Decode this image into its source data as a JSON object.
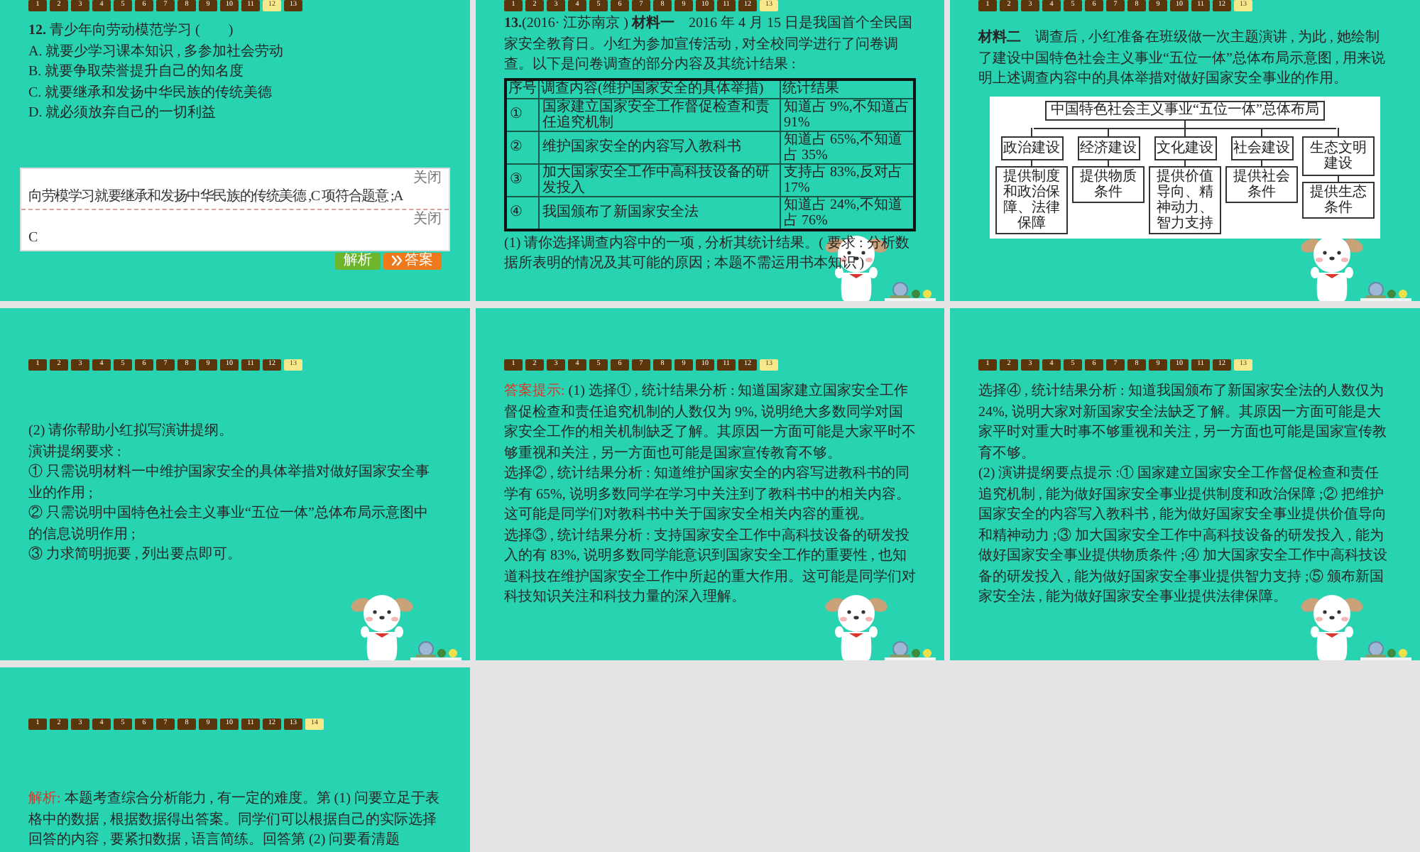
{
  "slides": [
    {
      "kind": "question",
      "mascot": false,
      "nav": [
        {
          "label": "1",
          "selected": false
        },
        {
          "label": "2",
          "selected": false
        },
        {
          "label": "3",
          "selected": false
        },
        {
          "label": "4",
          "selected": false
        },
        {
          "label": "5",
          "selected": false
        },
        {
          "label": "6",
          "selected": false
        },
        {
          "label": "7",
          "selected": false
        },
        {
          "label": "8",
          "selected": false
        },
        {
          "label": "9",
          "selected": false
        },
        {
          "label": "10",
          "selected": false
        },
        {
          "label": "11",
          "selected": false
        },
        {
          "label": "12",
          "selected": true
        },
        {
          "label": "13",
          "selected": false
        }
      ],
      "question": "**12.** 青少年向劳动模范学习 (　　)",
      "options": [
        "A. 就要少学习课本知识 , 多参加社会劳动",
        "B. 就要争取荣誉提升自己的知名度",
        "C. 就要继承和发扬中华民族的传统美德",
        "D. 就必须放弃自己的一切利益"
      ],
      "panels": [
        {
          "close": "关闭",
          "text": "向劳模学习就要继承和发扬中华民族的传统美德 ,C 项符合题意 ;A"
        },
        {
          "close": "关闭",
          "text": "C"
        }
      ],
      "buttons": [
        "解析",
        "答案"
      ]
    },
    {
      "kind": "table",
      "mascot": true,
      "nav": [
        {
          "label": "1",
          "selected": false
        },
        {
          "label": "2",
          "selected": false
        },
        {
          "label": "3",
          "selected": false
        },
        {
          "label": "4",
          "selected": false
        },
        {
          "label": "5",
          "selected": false
        },
        {
          "label": "6",
          "selected": false
        },
        {
          "label": "7",
          "selected": false
        },
        {
          "label": "8",
          "selected": false
        },
        {
          "label": "9",
          "selected": false
        },
        {
          "label": "10",
          "selected": false
        },
        {
          "label": "11",
          "selected": false
        },
        {
          "label": "12",
          "selected": false
        },
        {
          "label": "13",
          "selected": true
        }
      ],
      "intro": "**13.**(2016· 江苏南京 ) **材料一**　2016 年 4 月 15 日是我国首个全民国家安全教育日。小红为参加宣传活动 , 对全校同学进行了问卷调查。以下是问卷调查的部分内容及其统计结果 :",
      "table": {
        "columns": [
          "序号",
          "调查内容(维护国家安全的具体举措)",
          "统计结果"
        ],
        "rows": [
          [
            "①",
            "国家建立国家安全工作督促检查和责任追究机制",
            "知道占 9%,不知道占 91%"
          ],
          [
            "②",
            "维护国家安全的内容写入教科书",
            "知道占 65%,不知道占 35%"
          ],
          [
            "③",
            "加大国家安全工作中高科技设备的研发投入",
            "支持占 83%,反对占 17%"
          ],
          [
            "④",
            "我国颁布了新国家安全法",
            "知道占 24%,不知道占 76%"
          ]
        ]
      },
      "question": "(1) 请你选择调查内容中的一项 , 分析其统计结果。( 要求 : 分析数据所表明的情况及其可能的原因 ; 本题不需运用书本知识 )"
    },
    {
      "kind": "diagram",
      "mascot": true,
      "nav": [
        {
          "label": "1",
          "selected": false
        },
        {
          "label": "2",
          "selected": false
        },
        {
          "label": "3",
          "selected": false
        },
        {
          "label": "4",
          "selected": false
        },
        {
          "label": "5",
          "selected": false
        },
        {
          "label": "6",
          "selected": false
        },
        {
          "label": "7",
          "selected": false
        },
        {
          "label": "8",
          "selected": false
        },
        {
          "label": "9",
          "selected": false
        },
        {
          "label": "10",
          "selected": false
        },
        {
          "label": "11",
          "selected": false
        },
        {
          "label": "12",
          "selected": false
        },
        {
          "label": "13",
          "selected": true
        }
      ],
      "intro": "**材料二**　调查后 , 小红准备在班级做一次主题演讲 , 为此 , 她绘制了建设中国特色社会主义事业“五位一体”总体布局示意图 , 用来说明上述调查内容中的具体举措对做好国家安全事业的作用。",
      "diagram": {
        "title": "中国特色社会主义事业“五位一体”总体布局",
        "branches": [
          {
            "label": "政治建设",
            "detail": "提供制度和政治保障、法律保障"
          },
          {
            "label": "经济建设",
            "detail": "提供物质条件"
          },
          {
            "label": "文化建设",
            "detail": "提供价值导向、精神动力、智力支持"
          },
          {
            "label": "社会建设",
            "detail": "提供社会条件"
          },
          {
            "label": "生态文明建设",
            "detail": "提供生态条件"
          }
        ]
      }
    },
    {
      "kind": "prompt",
      "mascot": true,
      "nav": [
        {
          "label": "1",
          "selected": false
        },
        {
          "label": "2",
          "selected": false
        },
        {
          "label": "3",
          "selected": false
        },
        {
          "label": "4",
          "selected": false
        },
        {
          "label": "5",
          "selected": false
        },
        {
          "label": "6",
          "selected": false
        },
        {
          "label": "7",
          "selected": false
        },
        {
          "label": "8",
          "selected": false
        },
        {
          "label": "9",
          "selected": false
        },
        {
          "label": "10",
          "selected": false
        },
        {
          "label": "11",
          "selected": false
        },
        {
          "label": "12",
          "selected": false
        },
        {
          "label": "13",
          "selected": true
        }
      ],
      "paragraphs": [
        "(2) 请你帮助小红拟写演讲提纲。",
        "演讲提纲要求 :",
        "① 只需说明材料一中维护国家安全的具体举措对做好国家安全事业的作用 ;",
        "② 只需说明中国特色社会主义事业“五位一体”总体布局示意图中的信息说明作用 ;",
        "③ 力求简明扼要 , 列出要点即可。"
      ]
    },
    {
      "kind": "answer",
      "mascot": true,
      "nav": [
        {
          "label": "1",
          "selected": false
        },
        {
          "label": "2",
          "selected": false
        },
        {
          "label": "3",
          "selected": false
        },
        {
          "label": "4",
          "selected": false
        },
        {
          "label": "5",
          "selected": false
        },
        {
          "label": "6",
          "selected": false
        },
        {
          "label": "7",
          "selected": false
        },
        {
          "label": "8",
          "selected": false
        },
        {
          "label": "9",
          "selected": false
        },
        {
          "label": "10",
          "selected": false
        },
        {
          "label": "11",
          "selected": false
        },
        {
          "label": "12",
          "selected": false
        },
        {
          "label": "13",
          "selected": true
        }
      ],
      "label": "答案提示:",
      "paragraphs": [
        "(1) 选择① , 统计结果分析 : 知道国家建立国家安全工作督促检查和责任追究机制的人数仅为 9%, 说明绝大多数同学对国家安全工作的相关机制缺乏了解。其原因一方面可能是大家平时不够重视和关注 , 另一方面也可能是国家宣传教育不够。",
        "选择② , 统计结果分析 : 知道维护国家安全的内容写进教科书的同学有 65%, 说明多数同学在学习中关注到了教科书中的相关内容。这可能是同学们对教科书中关于国家安全相关内容的重视。",
        "选择③ , 统计结果分析 : 支持国家安全工作中高科技设备的研发投入的有 83%, 说明多数同学能意识到国家安全工作的重要性 , 也知道科技在维护国家安全工作中所起的重大作用。这可能是同学们对科技知识关注和科技力量的深入理解。"
      ]
    },
    {
      "kind": "answer",
      "mascot": true,
      "nav": [
        {
          "label": "1",
          "selected": false
        },
        {
          "label": "2",
          "selected": false
        },
        {
          "label": "3",
          "selected": false
        },
        {
          "label": "4",
          "selected": false
        },
        {
          "label": "5",
          "selected": false
        },
        {
          "label": "6",
          "selected": false
        },
        {
          "label": "7",
          "selected": false
        },
        {
          "label": "8",
          "selected": false
        },
        {
          "label": "9",
          "selected": false
        },
        {
          "label": "10",
          "selected": false
        },
        {
          "label": "11",
          "selected": false
        },
        {
          "label": "12",
          "selected": false
        },
        {
          "label": "13",
          "selected": true
        }
      ],
      "paragraphs": [
        "选择④ , 统计结果分析 : 知道我国颁布了新国家安全法的人数仅为 24%, 说明大家对新国家安全法缺乏了解。其原因一方面可能是大家平时对重大时事不够重视和关注 , 另一方面也可能是国家宣传教育不够。",
        "(2) 演讲提纲要点提示 :① 国家建立国家安全工作督促检查和责任追究机制 , 能为做好国家安全事业提供制度和政治保障 ;② 把维护国家安全的内容写入教科书 , 能为做好国家安全事业提供价值导向和精神动力 ;③ 加大国家安全工作中高科技设备的研发投入 , 能为做好国家安全事业提供物质条件 ;④ 加大国家安全工作中高科技设备的研发投入 , 能为做好国家安全事业提供智力支持 ;⑤ 颁布新国家安全法 , 能为做好国家安全事业提供法律保障。"
      ]
    },
    {
      "kind": "analysis",
      "mascot": false,
      "nav": [
        {
          "label": "1",
          "selected": false
        },
        {
          "label": "2",
          "selected": false
        },
        {
          "label": "3",
          "selected": false
        },
        {
          "label": "4",
          "selected": false
        },
        {
          "label": "5",
          "selected": false
        },
        {
          "label": "6",
          "selected": false
        },
        {
          "label": "7",
          "selected": false
        },
        {
          "label": "8",
          "selected": false
        },
        {
          "label": "9",
          "selected": false
        },
        {
          "label": "10",
          "selected": false
        },
        {
          "label": "11",
          "selected": false
        },
        {
          "label": "12",
          "selected": false
        },
        {
          "label": "13",
          "selected": false
        },
        {
          "label": "14",
          "selected": true
        }
      ],
      "label": "解析:",
      "paragraphs": [
        "本题考查综合分析能力 , 有一定的难度。第 (1) 问要立足于表格中的数据 , 根据数据得出答案。同学们可以根据自己的实际选择回答的内容 , 要紧扣数据 , 语言简练。回答第 (2) 问要看清题"
      ]
    }
  ]
}
